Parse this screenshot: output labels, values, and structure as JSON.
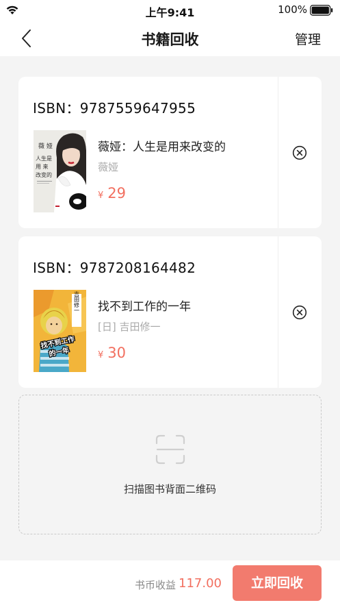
{
  "status_bar": {
    "time": "上午9:41",
    "battery": "100%"
  },
  "nav": {
    "title": "书籍回收",
    "manage": "管理"
  },
  "books": [
    {
      "isbn_label": "ISBN：9787559647955",
      "title": "薇娅：人生是用来改变的",
      "author": "薇娅",
      "currency": "¥",
      "price": "29",
      "cover_text_1": "薇 娅",
      "cover_text_2": "人生是",
      "cover_text_3": "用 来",
      "cover_text_4": "改变的"
    },
    {
      "isbn_label": "ISBN：9787208164482",
      "title": "找不到工作的一年",
      "author": "[日] 吉田修一",
      "currency": "¥",
      "price": "30",
      "cover_text_1": "吉田修一",
      "cover_text_2": "找不到工作",
      "cover_text_3": "的一年"
    }
  ],
  "scan": {
    "label": "扫描图书背面二维码"
  },
  "footer": {
    "earn_label": "书币收益",
    "earn_amount": "117.00",
    "button": "立即回收"
  },
  "colors": {
    "accent": "#f27b6e",
    "price": "#f26f5f"
  }
}
